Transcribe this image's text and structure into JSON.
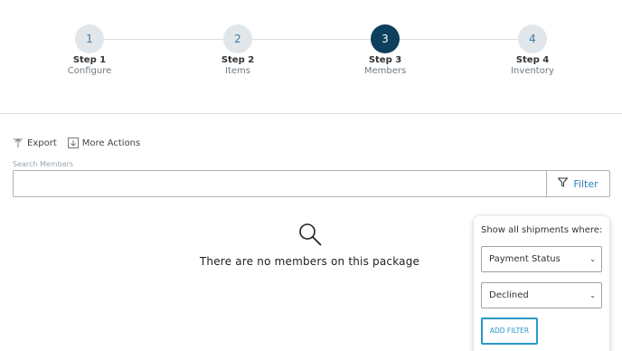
{
  "stepper": {
    "steps": [
      {
        "number": "1",
        "title": "Step 1",
        "subtitle": "Configure"
      },
      {
        "number": "2",
        "title": "Step 2",
        "subtitle": "Items"
      },
      {
        "number": "3",
        "title": "Step 3",
        "subtitle": "Members"
      },
      {
        "number": "4",
        "title": "Step 4",
        "subtitle": "Inventory"
      }
    ],
    "active_step": 3
  },
  "actions": {
    "export_label": "Export",
    "more_actions_label": "More Actions"
  },
  "search": {
    "label": "Search Members",
    "value": "",
    "filter_label": "Filter"
  },
  "empty_state": {
    "message": "There are no members on this package"
  },
  "filter_popover": {
    "title": "Show all shipments where:",
    "field_select": "Payment Status",
    "value_select": "Declined",
    "add_filter_label": "ADD FILTER"
  },
  "colors": {
    "active_step": "#0d3f5e",
    "inactive_step": "#e1e6ea",
    "accent": "#2f7db3"
  },
  "icons": [
    "export-icon",
    "more-actions-icon",
    "filter-icon",
    "search-icon",
    "chevron-down-icon"
  ]
}
